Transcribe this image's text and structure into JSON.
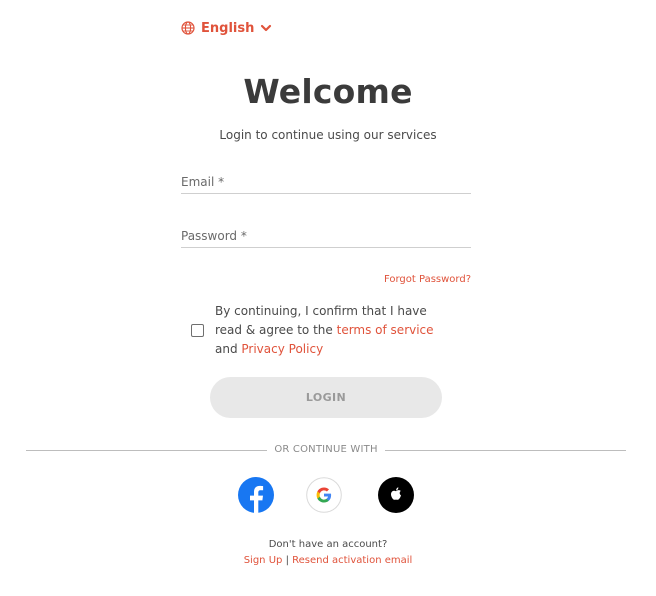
{
  "language": {
    "selected": "English"
  },
  "header": {
    "title": "Welcome",
    "subtitle": "Login to continue using our services"
  },
  "form": {
    "email_label": "Email *",
    "email_value": "",
    "password_label": "Password *",
    "password_value": "",
    "forgot_password": "Forgot Password?"
  },
  "consent": {
    "text_before": "By continuing, I confirm that I have read & agree to the ",
    "terms_link": "terms of service",
    "text_middle": " and ",
    "privacy_link": "Privacy Policy",
    "checked": false
  },
  "login_button": "LOGIN",
  "divider": "OR CONTINUE WITH",
  "social": [
    {
      "name": "Facebook",
      "icon": "facebook-icon",
      "color": "#1877f2"
    },
    {
      "name": "Google",
      "icon": "google-icon",
      "color": "#4285f4"
    },
    {
      "name": "Apple",
      "icon": "apple-icon",
      "color": "#000000"
    }
  ],
  "footer": {
    "question": "Don't have an account?",
    "signup": "Sign Up",
    "separator": "|",
    "resend": "Resend activation email"
  },
  "colors": {
    "accent": "#e0533b",
    "button_disabled_bg": "#e8e8e8",
    "button_disabled_text": "#9a9a9a"
  }
}
